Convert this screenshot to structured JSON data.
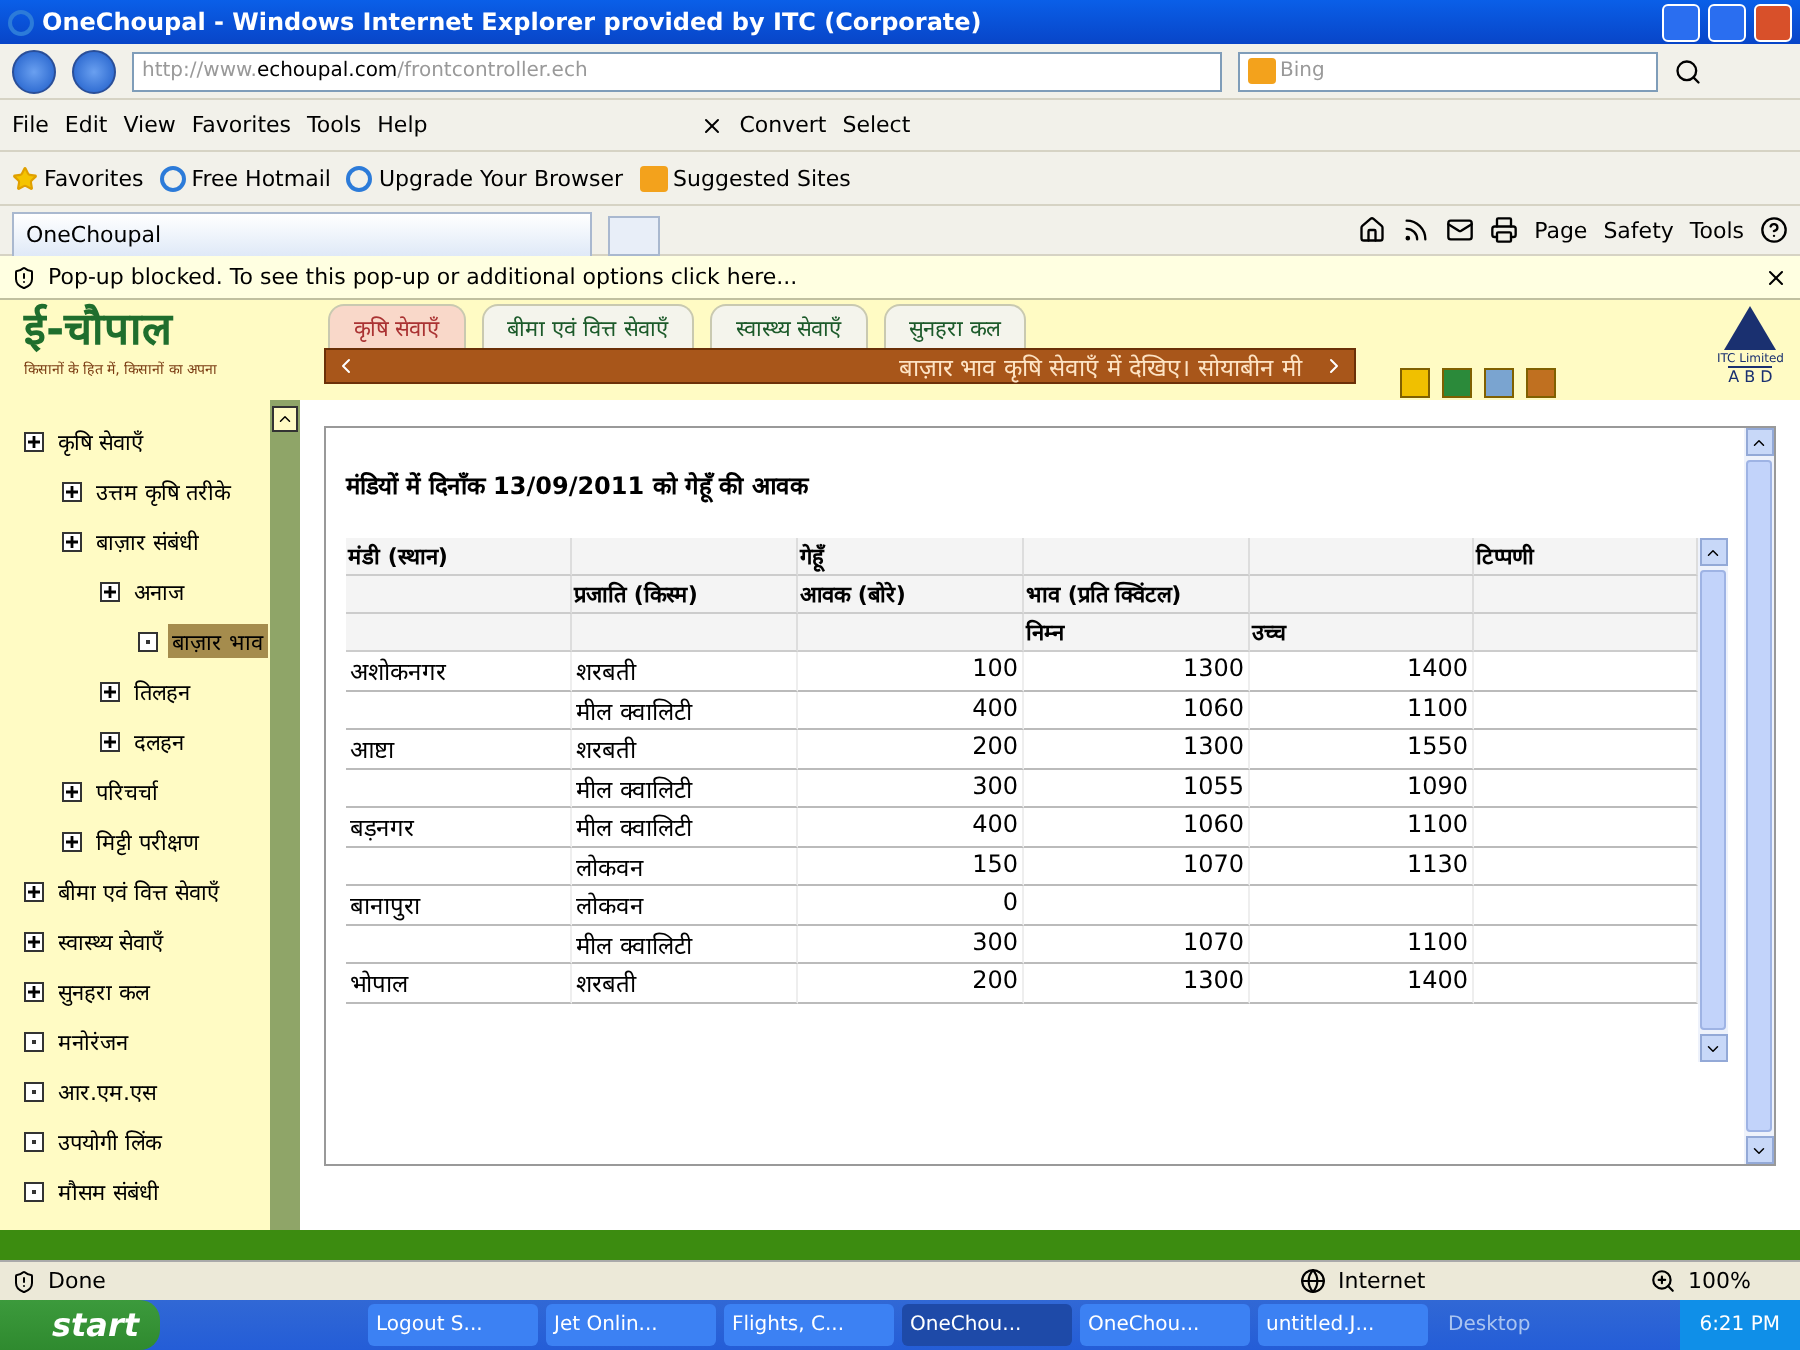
{
  "window": {
    "title": "OneChoupal - Windows Internet Explorer provided by ITC (Corporate)"
  },
  "address_bar": {
    "url_prefix": "http://www.",
    "url_domain": "echoupal.com",
    "url_path": "/frontcontroller.ech",
    "search_placeholder": "Bing"
  },
  "menu": [
    "File",
    "Edit",
    "View",
    "Favorites",
    "Tools",
    "Help"
  ],
  "toolbar_buttons": [
    "Convert",
    "Select"
  ],
  "favorites_bar": [
    {
      "label": "Favorites",
      "kind": "star"
    },
    {
      "label": "Free Hotmail",
      "kind": "page"
    },
    {
      "label": "Upgrade Your Browser",
      "kind": "page"
    },
    {
      "label": "Suggested Sites",
      "kind": "bing"
    }
  ],
  "tabs": [
    {
      "label": "OneChoupal",
      "selected": true
    }
  ],
  "command_bar": [
    "Page",
    "Safety",
    "Tools"
  ],
  "popup_message": "Pop-up blocked. To see this pop-up or additional options click here...",
  "site": {
    "logo": "ई-चौपाल",
    "tagline": "किसानों के हित में, किसानों का अपना",
    "tabs": [
      {
        "label": "कृषि सेवाएँ",
        "selected": true
      },
      {
        "label": "बीमा एवं वित्त सेवाएँ",
        "selected": false
      },
      {
        "label": "स्वास्थ्य सेवाएँ",
        "selected": false
      },
      {
        "label": "सुनहरा कल",
        "selected": false
      }
    ],
    "ticker": "बाज़ार भाव कृषि सेवाएँ में देखिए। सोयाबीन मी",
    "brand_top": "ITC Limited",
    "brand_bottom": "A B D"
  },
  "sidebar": [
    {
      "label": "कृषि सेवाएँ",
      "kind": "folder",
      "selected": false,
      "children": [
        {
          "label": "उत्तम कृषि तरीके",
          "kind": "folder",
          "selected": false
        },
        {
          "label": "बाज़ार संबंधी",
          "kind": "folder",
          "selected": false,
          "children": [
            {
              "label": "अनाज",
              "kind": "folder",
              "selected": false,
              "children": [
                {
                  "label": "बाज़ार भाव",
                  "kind": "leaf",
                  "selected": true
                }
              ]
            },
            {
              "label": "तिलहन",
              "kind": "folder",
              "selected": false
            },
            {
              "label": "दलहन",
              "kind": "folder",
              "selected": false
            }
          ]
        },
        {
          "label": "परिचर्चा",
          "kind": "folder",
          "selected": false
        },
        {
          "label": "मिट्टी परीक्षण",
          "kind": "folder",
          "selected": false
        }
      ]
    },
    {
      "label": "बीमा एवं वित्त सेवाएँ",
      "kind": "folder",
      "selected": false
    },
    {
      "label": "स्वास्थ्य सेवाएँ",
      "kind": "folder",
      "selected": false
    },
    {
      "label": "सुनहरा कल",
      "kind": "folder",
      "selected": false
    },
    {
      "label": "मनोरंजन",
      "kind": "leaf",
      "selected": false
    },
    {
      "label": "आर.एम.एस",
      "kind": "leaf",
      "selected": false
    },
    {
      "label": "उपयोगी लिंक",
      "kind": "leaf",
      "selected": false
    },
    {
      "label": "मौसम संबंधी",
      "kind": "leaf",
      "selected": false
    }
  ],
  "table": {
    "title": "मंडियों में दिनाँक 13/09/2011 को गेहूँ की आवक",
    "header_rows": [
      [
        "मंडी (स्थान)",
        null,
        "गेहूँ",
        null,
        null,
        "टिप्पणी"
      ],
      [
        null,
        "प्रजाति (किस्म)",
        "आवक (बोरे)",
        "भाव (प्रति क्विंटल)",
        null,
        null
      ],
      [
        null,
        null,
        null,
        "निम्न",
        "उच्च",
        null
      ]
    ],
    "rows": [
      [
        "अशोकनगर",
        "शरबती",
        "100",
        "1300",
        "1400"
      ],
      [
        null,
        "मील क्वालिटी",
        "400",
        "1060",
        "1100"
      ],
      [
        "आष्टा",
        "शरबती",
        "200",
        "1300",
        "1550"
      ],
      [
        null,
        "मील क्वालिटी",
        "300",
        "1055",
        "1090"
      ],
      [
        "बड़नगर",
        "मील क्वालिटी",
        "400",
        "1060",
        "1100"
      ],
      [
        null,
        "लोकवन",
        "150",
        "1070",
        "1130"
      ],
      [
        "बानापुरा",
        "लोकवन",
        "0",
        null,
        null
      ],
      [
        null,
        "मील क्वालिटी",
        "300",
        "1070",
        "1100"
      ],
      [
        "भोपाल",
        "शरबती",
        "200",
        "1300",
        "1400"
      ]
    ]
  },
  "status_bar": {
    "text": "Done",
    "zone": "Internet",
    "zoom": "100%"
  },
  "taskbar": {
    "start": "start",
    "items": [
      {
        "label": "Logout S...",
        "selected": false
      },
      {
        "label": "Jet Onlin...",
        "selected": false
      },
      {
        "label": "Flights, C...",
        "selected": false
      },
      {
        "label": "OneChou...",
        "selected": true
      },
      {
        "label": "OneChou...",
        "selected": false
      },
      {
        "label": "untitled.J...",
        "selected": false
      }
    ],
    "desktop": "Desktop",
    "clock": "6:21 PM"
  }
}
